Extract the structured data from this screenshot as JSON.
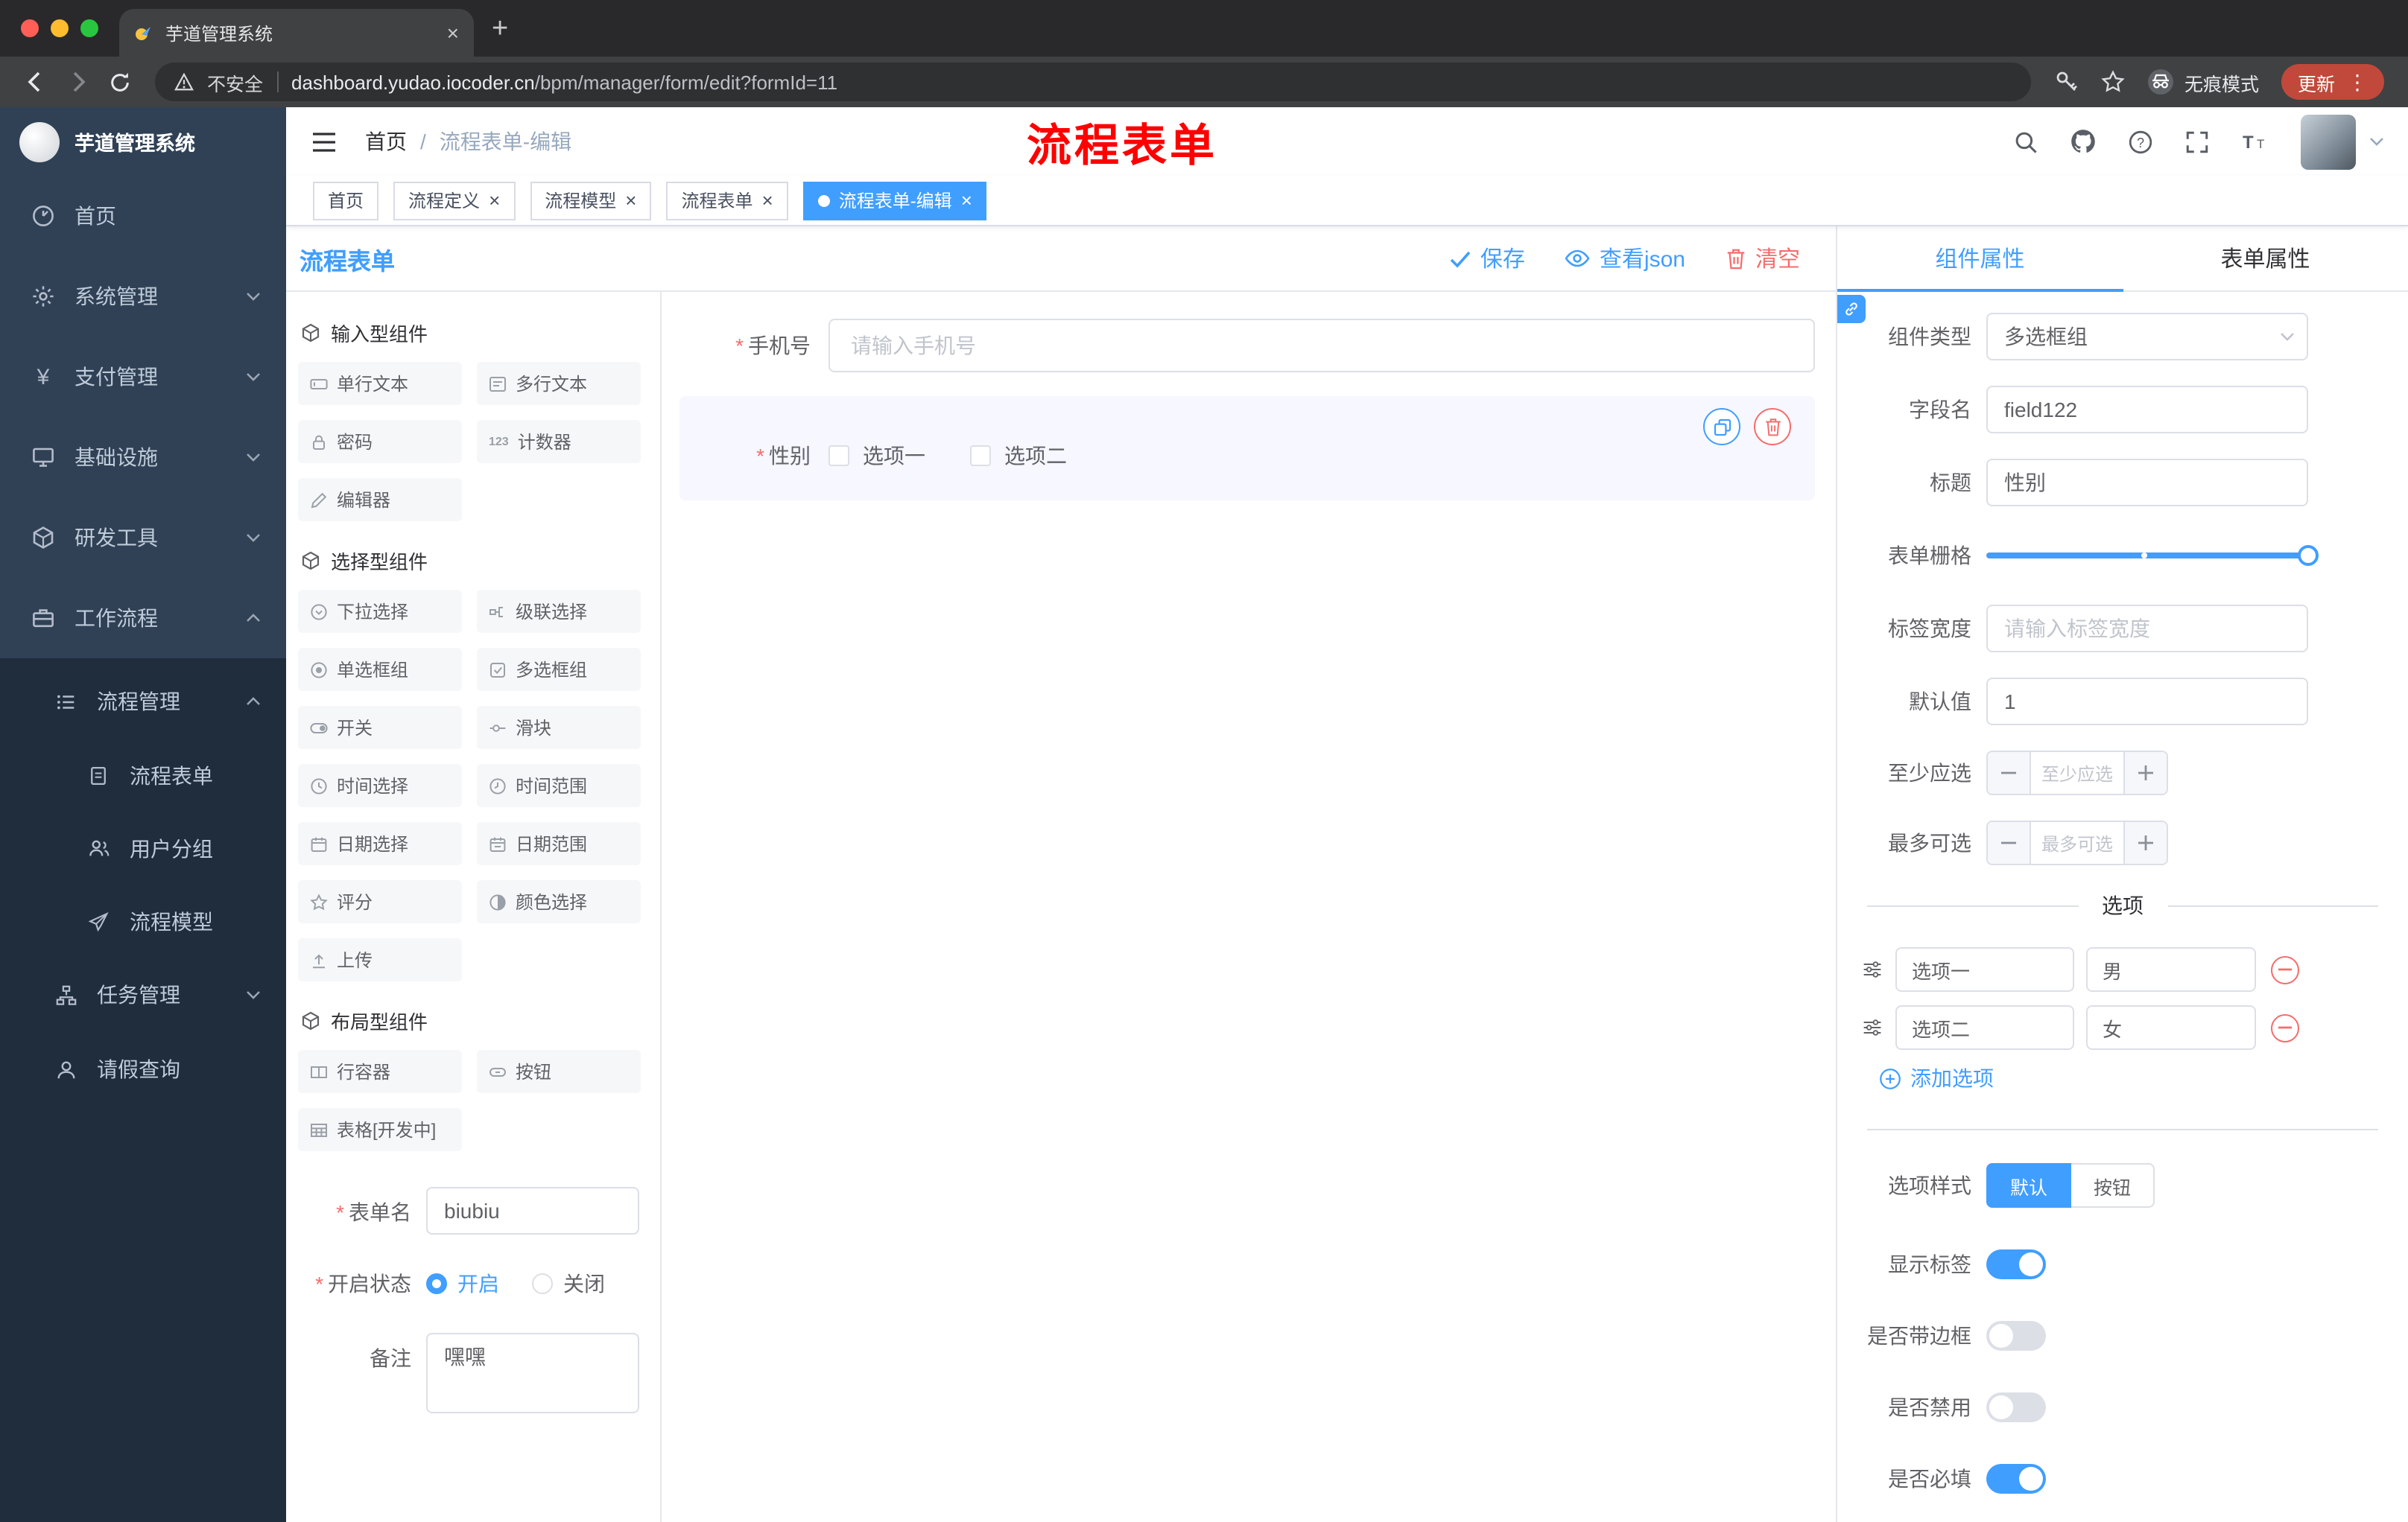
{
  "browser": {
    "tab_title": "芋道管理系统",
    "security": "不安全",
    "url_domain": "dashboard.yudao.iocoder.cn",
    "url_path": "/bpm/manager/form/edit?formId=11",
    "incognito": "无痕模式",
    "update": "更新"
  },
  "sidebar": {
    "logo": "芋道管理系统",
    "items": [
      "首页",
      "系统管理",
      "支付管理",
      "基础设施",
      "研发工具",
      "工作流程"
    ],
    "sub": {
      "pm": "流程管理",
      "form": "流程表单",
      "group": "用户分组",
      "model": "流程模型",
      "task": "任务管理",
      "leave": "请假查询"
    }
  },
  "header": {
    "crumb1": "首页",
    "sep": "/",
    "crumb2": "流程表单-编辑",
    "annotation": "流程表单"
  },
  "tags": [
    {
      "label": "首页",
      "closable": false,
      "active": false
    },
    {
      "label": "流程定义",
      "closable": true,
      "active": false
    },
    {
      "label": "流程模型",
      "closable": true,
      "active": false
    },
    {
      "label": "流程表单",
      "closable": true,
      "active": false
    },
    {
      "label": "流程表单-编辑",
      "closable": true,
      "active": true
    }
  ],
  "designer": {
    "title": "流程表单",
    "actions": {
      "save": "保存",
      "view_json": "查看json",
      "clear": "清空"
    },
    "palette": [
      {
        "title": "输入型组件",
        "items": [
          "单行文本",
          "多行文本",
          "密码",
          "计数器",
          "编辑器"
        ]
      },
      {
        "title": "选择型组件",
        "items": [
          "下拉选择",
          "级联选择",
          "单选框组",
          "多选框组",
          "开关",
          "滑块",
          "时间选择",
          "时间范围",
          "日期选择",
          "日期范围",
          "评分",
          "颜色选择",
          "上传"
        ]
      },
      {
        "title": "布局型组件",
        "items": [
          "行容器",
          "按钮",
          "表格[开发中]"
        ]
      }
    ],
    "meta": {
      "form_name_label": "表单名",
      "form_name_value": "biubiu",
      "status_label": "开启状态",
      "status_on": "开启",
      "status_off": "关闭",
      "status_value": "开启",
      "remark_label": "备注",
      "remark_value": "嘿嘿"
    },
    "canvas": {
      "phone_label": "手机号",
      "phone_placeholder": "请输入手机号",
      "gender_label": "性别",
      "gender_options": [
        "选项一",
        "选项二"
      ]
    }
  },
  "props": {
    "tabs": [
      "组件属性",
      "表单属性"
    ],
    "active_tab": "组件属性",
    "component_type_label": "组件类型",
    "component_type_value": "多选框组",
    "field_name_label": "字段名",
    "field_name_value": "field122",
    "title_label": "标题",
    "title_value": "性别",
    "grid_label": "表单栅格",
    "label_width_label": "标签宽度",
    "label_width_placeholder": "请输入标签宽度",
    "default_label": "默认值",
    "default_value": "1",
    "min_label": "至少应选",
    "min_placeholder": "至少应选",
    "max_label": "最多可选",
    "max_placeholder": "最多可选",
    "options_divider": "选项",
    "options": [
      {
        "label": "选项一",
        "value": "男"
      },
      {
        "label": "选项二",
        "value": "女"
      }
    ],
    "add_option": "添加选项",
    "style_label": "选项样式",
    "style_default": "默认",
    "style_button": "按钮",
    "style_value": "默认",
    "show_label": "显示标签",
    "show_label_on": true,
    "border_label": "是否带边框",
    "border_on": false,
    "disabled_label": "是否禁用",
    "disabled_on": false,
    "required_label": "是否必填",
    "required_on": true
  },
  "colors": {
    "accent": "#409eff",
    "danger": "#f56c6c",
    "sidebar": "#304156",
    "submenu": "#1f2d3d"
  }
}
